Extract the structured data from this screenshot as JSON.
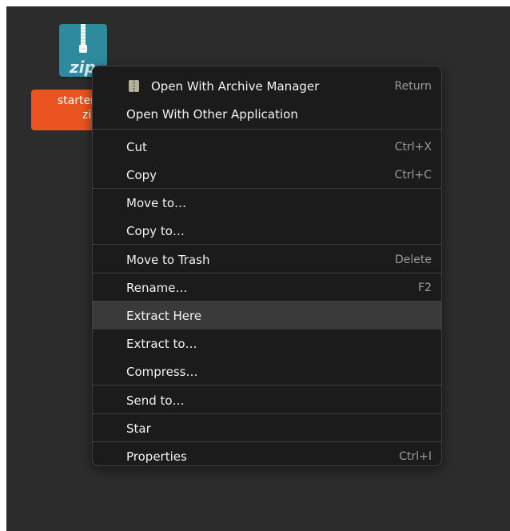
{
  "desktop": {
    "file": {
      "icon": "zip-archive-icon",
      "icon_text": "zip",
      "label_line1": "starter-",
      "label_line2": "zip"
    }
  },
  "context_menu": {
    "items": [
      {
        "label": "Open With Archive Manager",
        "accel": "Return",
        "icon": "archive-manager-icon"
      },
      {
        "label": "Open With Other Application",
        "accel": ""
      },
      {
        "label": "Cut",
        "accel": "Ctrl+X"
      },
      {
        "label": "Copy",
        "accel": "Ctrl+C"
      },
      {
        "label": "Move to…",
        "accel": ""
      },
      {
        "label": "Copy to…",
        "accel": ""
      },
      {
        "label": "Move to Trash",
        "accel": "Delete"
      },
      {
        "label": "Rename…",
        "accel": "F2"
      },
      {
        "label": "Extract Here",
        "accel": "",
        "highlighted": true
      },
      {
        "label": "Extract to…",
        "accel": ""
      },
      {
        "label": "Compress…",
        "accel": ""
      },
      {
        "label": "Send to…",
        "accel": ""
      },
      {
        "label": "Star",
        "accel": ""
      },
      {
        "label": "Properties",
        "accel": "Ctrl+I"
      }
    ]
  },
  "colors": {
    "desktop_bg": "#2c2c2c",
    "menu_bg": "#1b1b1b",
    "highlight": "#3a3a3a",
    "selection_accent": "#e95420",
    "zip_icon": "#2e8b9e"
  }
}
